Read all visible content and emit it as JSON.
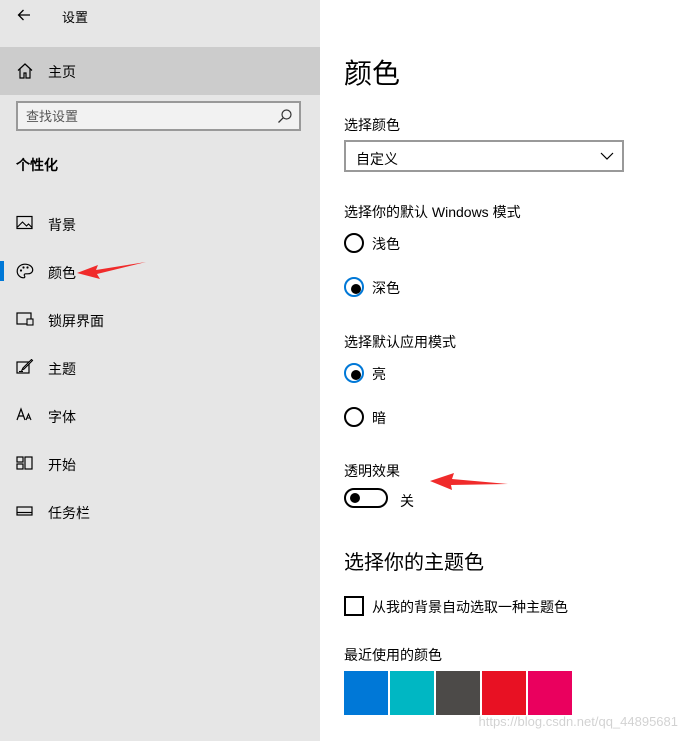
{
  "window": {
    "title": "设置",
    "back_icon": "back-arrow-icon"
  },
  "sidebar": {
    "home": {
      "label": "主页",
      "icon": "home-icon"
    },
    "search": {
      "placeholder": "查找设置",
      "icon": "search-icon"
    },
    "section_title": "个性化",
    "items": [
      {
        "label": "背景",
        "icon": "image-icon",
        "selected": false
      },
      {
        "label": "颜色",
        "icon": "palette-icon",
        "selected": true
      },
      {
        "label": "锁屏界面",
        "icon": "lock-screen-icon",
        "selected": false
      },
      {
        "label": "主题",
        "icon": "theme-brush-icon",
        "selected": false
      },
      {
        "label": "字体",
        "icon": "font-icon",
        "selected": false
      },
      {
        "label": "开始",
        "icon": "start-menu-icon",
        "selected": false
      },
      {
        "label": "任务栏",
        "icon": "taskbar-icon",
        "selected": false
      }
    ]
  },
  "content": {
    "title": "颜色",
    "choose_color": {
      "label": "选择颜色",
      "value": "自定义"
    },
    "windows_mode": {
      "label": "选择你的默认 Windows 模式",
      "options": [
        "浅色",
        "深色"
      ],
      "selected": "深色"
    },
    "app_mode": {
      "label": "选择默认应用模式",
      "options": [
        "亮",
        "暗"
      ],
      "selected": "亮"
    },
    "transparency": {
      "label": "透明效果",
      "state_label": "关",
      "on": false
    },
    "accent": {
      "title": "选择你的主题色",
      "auto_checkbox_label": "从我的背景自动选取一种主题色",
      "auto_checked": false,
      "recent_label": "最近使用的颜色",
      "recent_colors": [
        "#0078d7",
        "#00b7c3",
        "#4c4a48",
        "#e81123",
        "#ea005e"
      ]
    }
  },
  "watermark": "https://blog.csdn.net/qq_44895681",
  "annotation_color": "#f02b2b"
}
